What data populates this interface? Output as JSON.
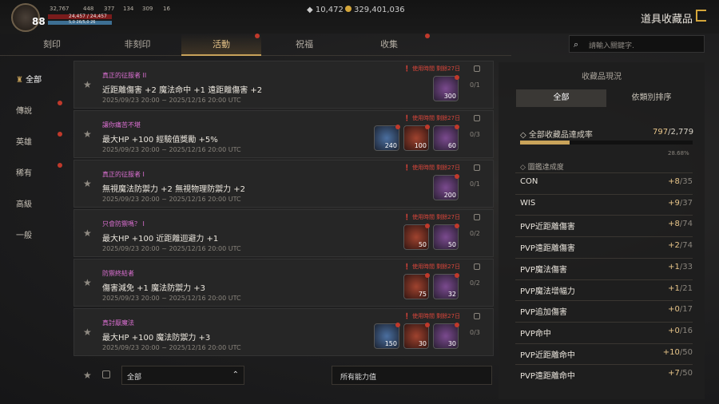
{
  "player": {
    "level": "88",
    "stat1": "32,767",
    "stat2": "448",
    "stat3": "377",
    "stat4": "134",
    "stat5": "309",
    "stat6": "16",
    "hp": "24,457 / 24,457",
    "mp": "5,0 26/5,0 26"
  },
  "currency": {
    "diamond": "10,472",
    "gold": "329,401,036"
  },
  "header": {
    "title": "道具收藏品"
  },
  "tabs": [
    {
      "label": "刻印"
    },
    {
      "label": "非刻印"
    },
    {
      "label": "活動"
    },
    {
      "label": "祝福"
    },
    {
      "label": "收集"
    }
  ],
  "search": {
    "placeholder": "請輸入關鍵字."
  },
  "sidebar": [
    {
      "label": "全部"
    },
    {
      "label": "傳說"
    },
    {
      "label": "英雄"
    },
    {
      "label": "稀有"
    },
    {
      "label": "高級"
    },
    {
      "label": "一般"
    }
  ],
  "items": [
    {
      "category": "真正的征服者 II",
      "effect": "近距離傷害 +2 魔法命中 +1 遠距離傷害 +2",
      "date": "2025/09/23 20:00 ~ 2025/12/16 20:00 UTC",
      "warning": "使用時間 剩餘27日",
      "count": "0/1",
      "slots": [
        {
          "color": "purple",
          "qty": "300"
        }
      ]
    },
    {
      "category": "讓你痛苦不堪",
      "effect": "最大HP +100 經驗值獎勵 +5%",
      "date": "2025/09/23 20:00 ~ 2025/12/16 20:00 UTC",
      "warning": "使用時間 剩餘27日",
      "count": "0/3",
      "slots": [
        {
          "color": "blue",
          "qty": "240"
        },
        {
          "color": "red",
          "qty": "100"
        },
        {
          "color": "purple",
          "qty": "60"
        }
      ]
    },
    {
      "category": "真正的征服者 I",
      "effect": "無視魔法防禦力 +2 無視物理防禦力 +2",
      "date": "2025/09/23 20:00 ~ 2025/12/16 20:00 UTC",
      "warning": "使用時間 剩餘27日",
      "count": "0/1",
      "slots": [
        {
          "color": "purple",
          "qty": "200"
        }
      ]
    },
    {
      "category": "只會防禦嗎？ I",
      "effect": "最大HP +100 近距離迴避力 +1",
      "date": "2025/09/23 20:00 ~ 2025/12/16 20:00 UTC",
      "warning": "使用時間 剩餘27日",
      "count": "0/2",
      "slots": [
        {
          "color": "red",
          "qty": "50"
        },
        {
          "color": "purple",
          "qty": "50"
        }
      ]
    },
    {
      "category": "防禦終結者",
      "effect": "傷害減免 +1 魔法防禦力 +3",
      "date": "2025/09/23 20:00 ~ 2025/12/16 20:00 UTC",
      "warning": "使用時間 剩餘27日",
      "count": "0/2",
      "slots": [
        {
          "color": "red",
          "qty": "75"
        },
        {
          "color": "purple",
          "qty": "32"
        }
      ]
    },
    {
      "category": "真討厭魔法",
      "effect": "最大HP +100 魔法防禦力 +3",
      "date": "2025/09/23 20:00 ~ 2025/12/16 20:00 UTC",
      "warning": "使用時間 剩餘27日",
      "count": "0/3",
      "slots": [
        {
          "color": "blue",
          "qty": "150"
        },
        {
          "color": "red",
          "qty": "30"
        },
        {
          "color": "purple",
          "qty": "30"
        }
      ]
    }
  ],
  "footer": {
    "filter1": "全部",
    "filter2": "所有能力值"
  },
  "panel": {
    "title": "收藏品現況",
    "tab_all": "全部",
    "tab_sort": "依類別排序",
    "rate_label": "全部收藏品達成率",
    "rate_current": "797",
    "rate_total": "/2,779",
    "rate_pct": "28.68%",
    "rate_fraction": 0.2868,
    "atlas": "圖鑑達成度",
    "bonuses": [
      {
        "name": "CON",
        "cur": "+8",
        "max": "/35"
      },
      {
        "name": "WIS",
        "cur": "+9",
        "max": "/37"
      },
      {
        "name": "PVP近距離傷害",
        "cur": "+8",
        "max": "/74"
      },
      {
        "name": "PVP遠距離傷害",
        "cur": "+2",
        "max": "/74"
      },
      {
        "name": "PVP魔法傷害",
        "cur": "+1",
        "max": "/33"
      },
      {
        "name": "PVP魔法增幅力",
        "cur": "+1",
        "max": "/21"
      },
      {
        "name": "PVP追加傷害",
        "cur": "+0",
        "max": "/17"
      },
      {
        "name": "PVP命中",
        "cur": "+0",
        "max": "/16"
      },
      {
        "name": "PVP近距離命中",
        "cur": "+10",
        "max": "/50"
      },
      {
        "name": "PVP遠距離命中",
        "cur": "+7",
        "max": "/50"
      }
    ]
  },
  "colors": {
    "accent": "#c9a35a",
    "alert": "#c0392b",
    "category": "#d96fd0"
  }
}
